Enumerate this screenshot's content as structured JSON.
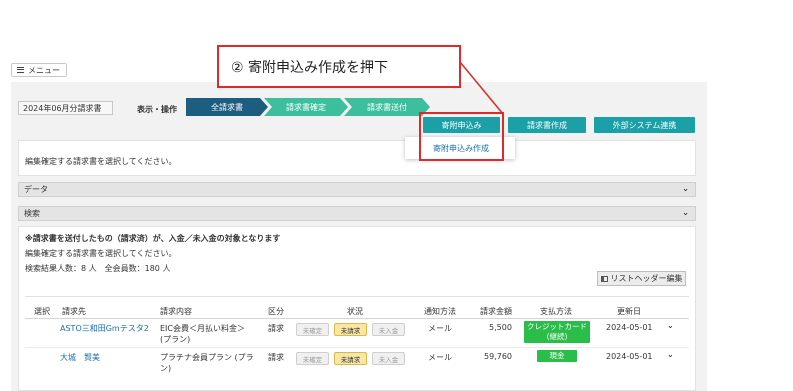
{
  "menu": {
    "label": "メニュー"
  },
  "header": {
    "month": "2024年06月分請求書",
    "display_label": "表示・操作"
  },
  "steps": [
    "全請求書",
    "請求書確定",
    "請求書送付"
  ],
  "toolbar": {
    "donation_label": "寄附申込み",
    "invoice_label": "請求書作成",
    "external_label": "外部システム連携"
  },
  "dropdown": {
    "item": "寄附申込み作成"
  },
  "callout": {
    "text": "② 寄附申込み作成を押下"
  },
  "notice": {
    "text": "編集確定する請求書を選択してください。"
  },
  "sections": {
    "data": "データ",
    "search": "検索"
  },
  "list": {
    "warning": "※請求書を送付したもの（請求済）が、入金／未入金の対象となります",
    "instruction": "編集確定する請求書を選択してください。",
    "count": "検索結果人数：8 人　全会員数：180 人",
    "header_button": "リストヘッダー編集"
  },
  "table": {
    "columns": [
      "選択",
      "請求先",
      "請求内容",
      "区分",
      "状況",
      "通知方法",
      "請求金額",
      "支払方法",
      "更新日"
    ],
    "rows": [
      {
        "name": "ASTO三和田Gmテスタ2",
        "content": "EIC会費＜月払い料金＞",
        "content2": "(プラン)",
        "type": "請求",
        "s1": "未確定",
        "s2": "未請求",
        "s3": "未入金",
        "notify": "メール",
        "amount": "5,500",
        "pay": "クレジットカード",
        "pay2": "(継続)",
        "date": "2024-05-01"
      },
      {
        "name": "大城　賢美",
        "content": "プラチナ会員プラン (プラ",
        "content2": "ン)",
        "type": "請求",
        "s1": "未確定",
        "s2": "未請求",
        "s3": "未入金",
        "notify": "メール",
        "amount": "59,760",
        "pay": "現金",
        "pay2": "",
        "date": "2024-05-01"
      }
    ]
  },
  "colors": {
    "accent_dark": "#1d5d80",
    "accent_green": "#3dbf9d",
    "teal_button": "#1aa0a6",
    "callout_red": "#e02a2a",
    "pay_green": "#2bbd4a"
  }
}
